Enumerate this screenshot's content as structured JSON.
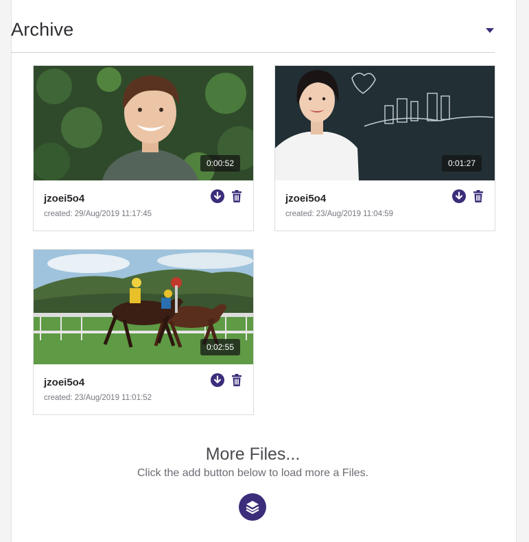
{
  "archive": {
    "title": "Archive"
  },
  "files": [
    {
      "name": "jzoei5o4",
      "created": "created: 29/Aug/2019 11:17:45",
      "duration": "0:00:52",
      "thumbnail": "smiling-man-plants"
    },
    {
      "name": "jzoei5o4",
      "created": "created: 23/Aug/2019 11:04:59",
      "duration": "0:01:27",
      "thumbnail": "woman-chalkboard"
    },
    {
      "name": "jzoei5o4",
      "created": "created: 23/Aug/2019 11:01:52",
      "duration": "0:02:55",
      "thumbnail": "horse-race"
    }
  ],
  "more": {
    "title": "More Files...",
    "subtitle": "Click the add button below to load more a Files."
  },
  "icons": {
    "download": "download-icon",
    "delete": "trash-icon",
    "load_more": "layers-icon",
    "collapse": "caret-down-icon"
  },
  "colors": {
    "accent": "#3b2d7a"
  }
}
